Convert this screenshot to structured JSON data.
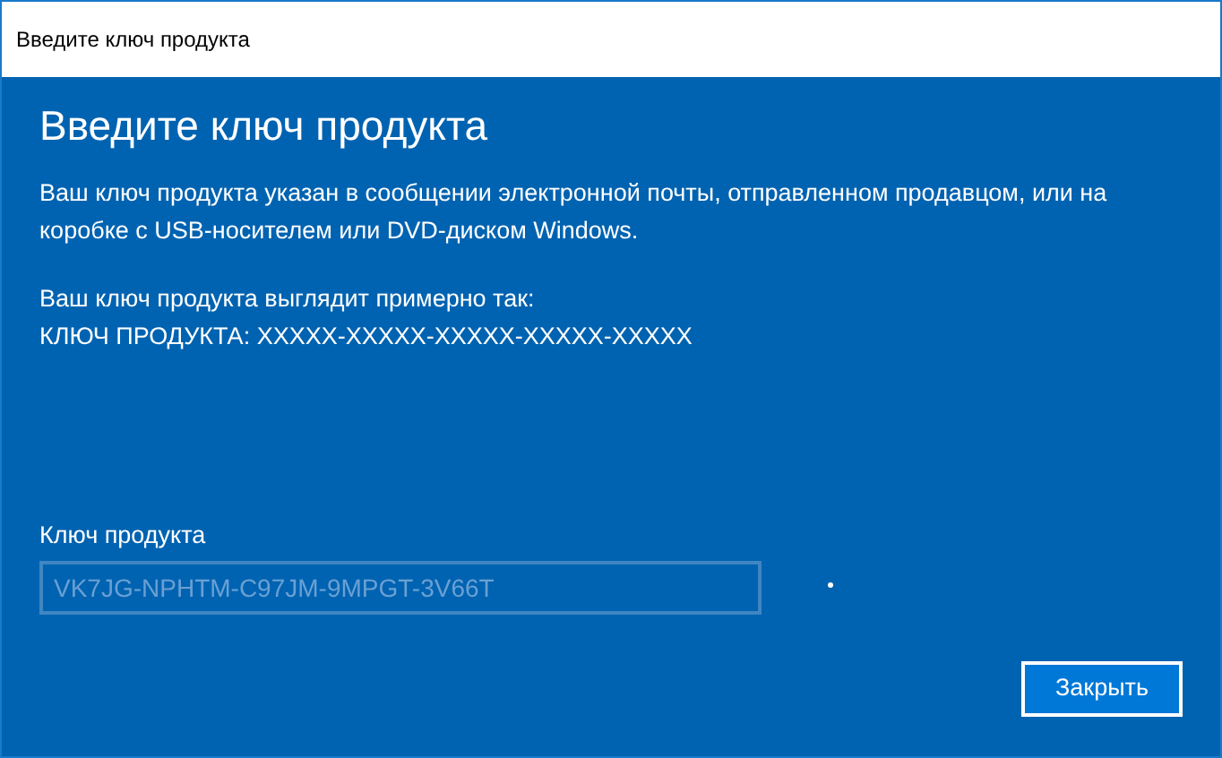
{
  "window": {
    "title": "Введите ключ продукта"
  },
  "heading": "Введите ключ продукта",
  "description": "Ваш ключ продукта указан в сообщении электронной почты, отправленном продавцом, или на коробке с USB-носителем или DVD-диском Windows.",
  "example_lines": [
    "Ваш ключ продукта выглядит примерно так:",
    "КЛЮЧ ПРОДУКТА: XXXXX-XXXXX-XXXXX-XXXXX-XXXXX"
  ],
  "key_field": {
    "label": "Ключ продукта",
    "value": "VK7JG-NPHTM-C97JM-9MPGT-3V66T",
    "disabled": true
  },
  "buttons": [
    {
      "label": "Закрыть",
      "focused": true
    }
  ]
}
